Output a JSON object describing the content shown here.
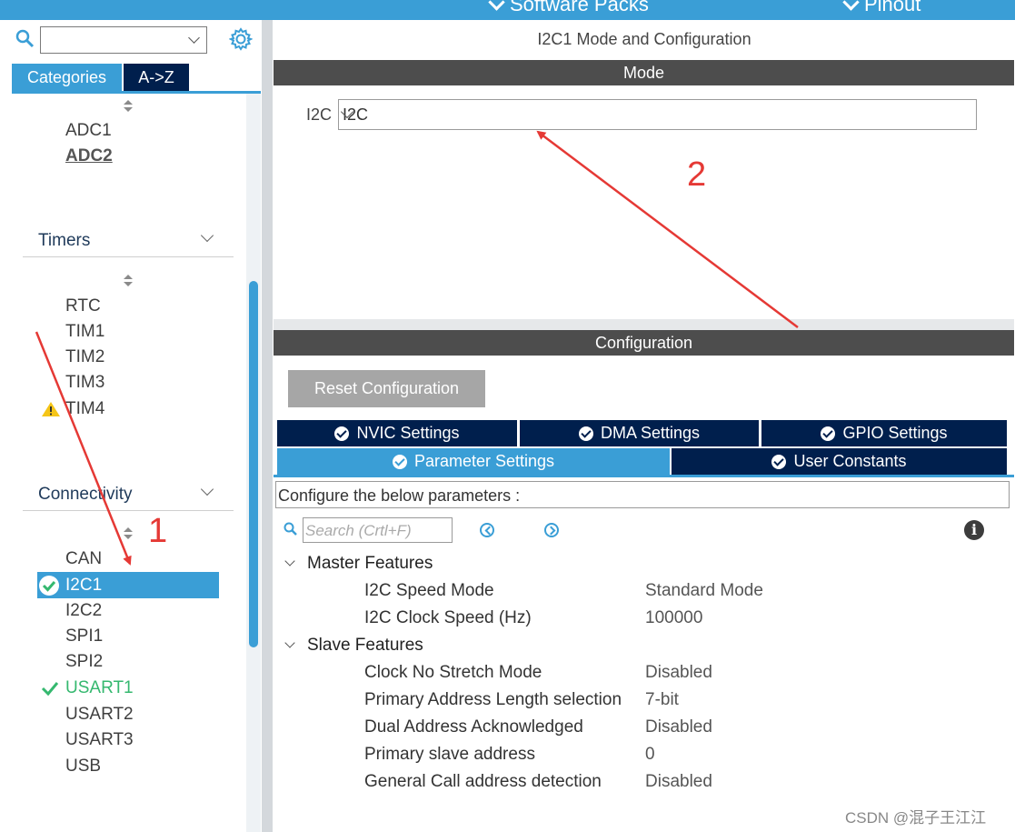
{
  "top_menu": [
    {
      "label": "Software Packs"
    },
    {
      "label": "Pinout"
    }
  ],
  "left": {
    "search": {
      "value": ""
    },
    "tabs": [
      {
        "label": "Categories"
      },
      {
        "label": "A->Z"
      }
    ],
    "analog_items": [
      {
        "label": "ADC1"
      },
      {
        "label": "ADC2"
      }
    ],
    "timers": {
      "header": "Timers",
      "items": [
        {
          "label": "RTC"
        },
        {
          "label": "TIM1"
        },
        {
          "label": "TIM2"
        },
        {
          "label": "TIM3"
        },
        {
          "label": "TIM4"
        }
      ]
    },
    "connectivity": {
      "header": "Connectivity",
      "items": [
        {
          "label": "CAN"
        },
        {
          "label": "I2C1"
        },
        {
          "label": "I2C2"
        },
        {
          "label": "SPI1"
        },
        {
          "label": "SPI2"
        },
        {
          "label": "USART1"
        },
        {
          "label": "USART2"
        },
        {
          "label": "USART3"
        },
        {
          "label": "USB"
        }
      ]
    }
  },
  "main": {
    "title": "I2C1 Mode and Configuration",
    "mode_header": "Mode",
    "i2c_label": "I2C",
    "i2c_value": "I2C",
    "config_header": "Configuration",
    "reset_button": "Reset Configuration",
    "tabs": [
      {
        "label": "NVIC Settings"
      },
      {
        "label": "DMA Settings"
      },
      {
        "label": "GPIO Settings"
      },
      {
        "label": "Parameter Settings"
      },
      {
        "label": "User Constants"
      }
    ],
    "configure_text": "Configure the below parameters :",
    "search_placeholder": "Search (Crtl+F)",
    "master": {
      "title": "Master Features",
      "params": [
        {
          "name": "I2C Speed Mode",
          "value": "Standard Mode"
        },
        {
          "name": "I2C Clock Speed (Hz)",
          "value": "100000"
        }
      ]
    },
    "slave": {
      "title": "Slave Features",
      "params": [
        {
          "name": "Clock No Stretch Mode",
          "value": "Disabled"
        },
        {
          "name": "Primary Address Length selection",
          "value": "7-bit"
        },
        {
          "name": "Dual Address Acknowledged",
          "value": "Disabled"
        },
        {
          "name": "Primary slave address",
          "value": "0"
        },
        {
          "name": "General Call address detection",
          "value": "Disabled"
        }
      ]
    }
  },
  "annotations": {
    "n1": "1",
    "n2": "2"
  },
  "watermark": "CSDN @混子王江江",
  "colors": {
    "accent": "#3a9ed6",
    "navy": "#001f4d",
    "dark_header": "#4d4d4d",
    "annotation": "#e53935",
    "ok_green": "#35b86f",
    "warning": "#f5c518"
  }
}
